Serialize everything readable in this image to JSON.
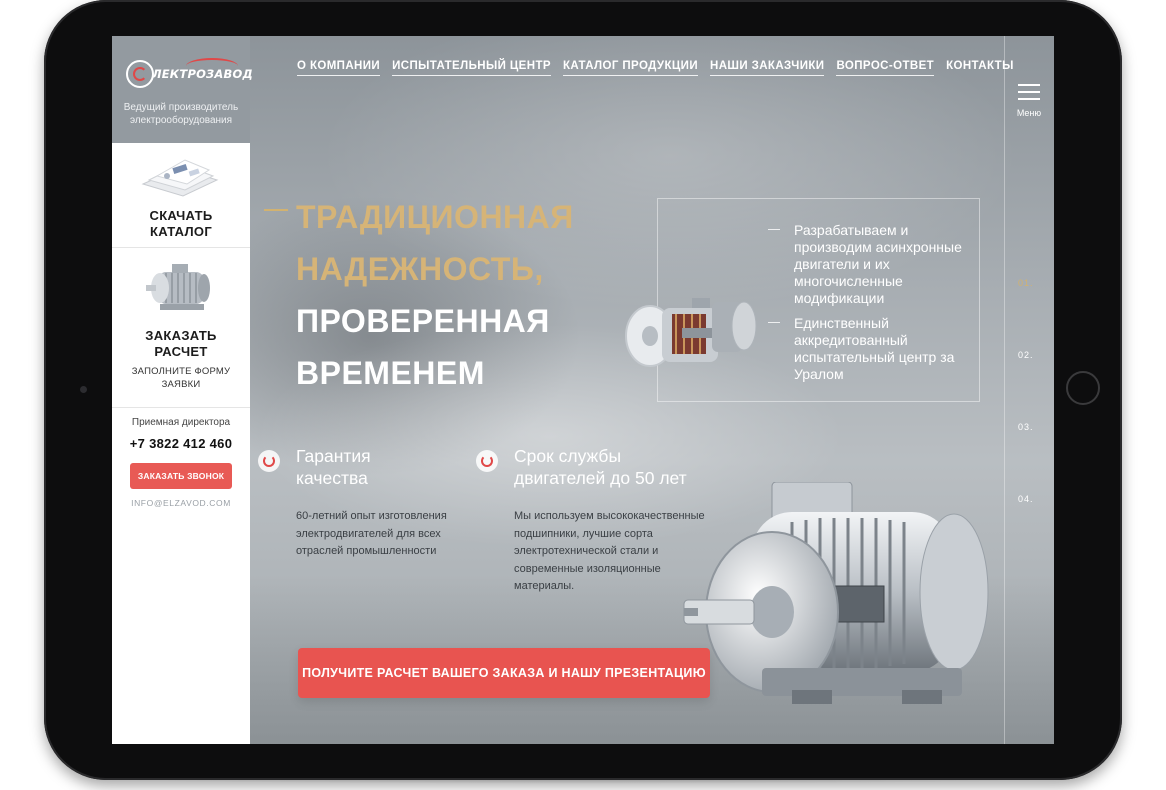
{
  "brand": {
    "logo_text": "ЛЕКТРОЗАВОД",
    "tagline": "Ведущий производитель электрооборудования"
  },
  "sidebar": {
    "catalog_label_line1": "СКАЧАТЬ",
    "catalog_label_line2": "КАТАЛОГ",
    "order_label_line1": "ЗАКАЗАТЬ",
    "order_label_line2": "РАСЧЕТ",
    "order_sub_line1": "ЗАПОЛНИТЕ ФОРМУ",
    "order_sub_line2": "ЗАЯВКИ",
    "reception_label": "Приемная директора",
    "phone": "+7 3822 412 460",
    "call_button": "ЗАКАЗАТЬ ЗВОНОК",
    "email": "INFO@ELZAVOD.COM"
  },
  "nav": {
    "items": [
      {
        "label": "О КОМПАНИИ"
      },
      {
        "label": "ИСПЫТАТЕЛЬНЫЙ ЦЕНТР"
      },
      {
        "label": "КАТАЛОГ ПРОДУКЦИИ"
      },
      {
        "label": "НАШИ ЗАКАЗЧИКИ"
      },
      {
        "label": "ВОПРОС-ОТВЕТ"
      },
      {
        "label": "КОНТАКТЫ"
      }
    ],
    "menu_label": "Меню"
  },
  "slides": {
    "items": [
      "01.",
      "02.",
      "03.",
      "04."
    ],
    "active_index": 0
  },
  "hero": {
    "line1": "ТРАДИЦИОННАЯ",
    "line2": "НАДЕЖНОСТЬ,",
    "line3": "ПРОВЕРЕННАЯ",
    "line4": "ВРЕМЕНЕМ"
  },
  "features": {
    "item1": "Разрабатываем и производим асинхронные двигатели и их многочисленные модификации",
    "item2": "Единственный аккредитованный испытательный центр за Уралом"
  },
  "advantages": [
    {
      "title_line1": "Гарантия",
      "title_line2": "качества",
      "text": "60-летний опыт изготовления электродвигателей для всех отраслей промышленности"
    },
    {
      "title_line1": "Срок службы",
      "title_line2": "двигателей до 50 лет",
      "text": "Мы используем высококачественные подшипники, лучшие сорта электротехнической стали и современные изоляционные материалы."
    }
  ],
  "cta": {
    "label": "ПОЛУЧИТЕ РАСЧЕТ ВАШЕГО ЗАКАЗА И НАШУ ПРЕЗЕНТАЦИЮ"
  },
  "colors": {
    "accent_red": "#e85450",
    "accent_gold": "#d6b477",
    "logo_bg": "#939aa0"
  },
  "icons": [
    "menu-icon",
    "quality-icon",
    "lifespan-icon",
    "catalog-image",
    "motor-image"
  ]
}
